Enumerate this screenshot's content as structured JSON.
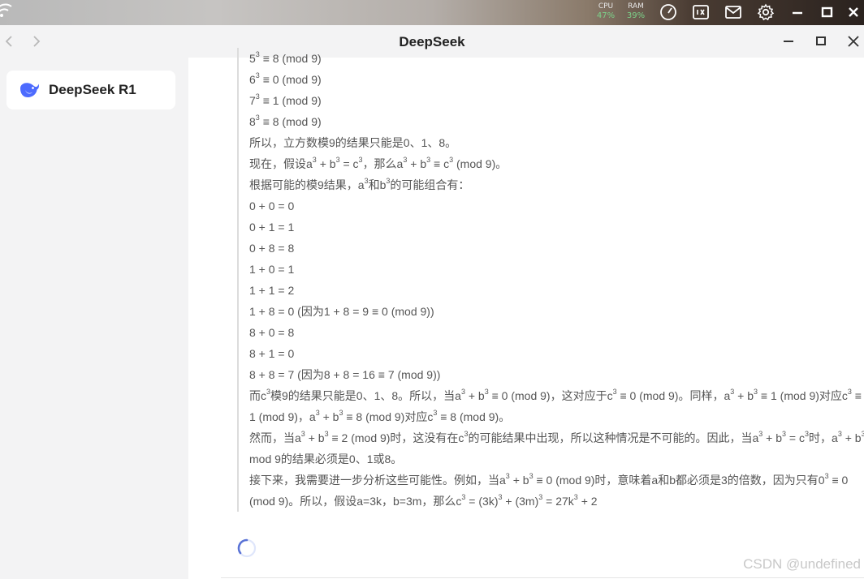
{
  "system_bar": {
    "cpu_label": "CPU",
    "cpu_value": "47%",
    "ram_label": "RAM",
    "ram_value": "39%",
    "icons": [
      "wifi-icon",
      "speedometer-icon",
      "monitor-icon",
      "mail-icon",
      "gear-icon",
      "minimize-icon",
      "maximize-icon",
      "close-icon"
    ]
  },
  "window": {
    "title": "DeepSeek",
    "nav_icons": [
      "back-arrow-icon",
      "forward-arrow-icon"
    ]
  },
  "sidebar": {
    "model_name": "DeepSeek R1",
    "model_icon": "deepseek-whale-icon",
    "accent": "#4d6bfe"
  },
  "thought_lines": [
    [
      [
        "t",
        "5"
      ],
      [
        "s",
        "3"
      ],
      [
        "t",
        " ≡ 8 (mod 9)"
      ]
    ],
    [
      [
        "t",
        "6"
      ],
      [
        "s",
        "3"
      ],
      [
        "t",
        " ≡ 0 (mod 9)"
      ]
    ],
    [
      [
        "t",
        "7"
      ],
      [
        "s",
        "3"
      ],
      [
        "t",
        " ≡ 1 (mod 9)"
      ]
    ],
    [
      [
        "t",
        "8"
      ],
      [
        "s",
        "3"
      ],
      [
        "t",
        " ≡ 8 (mod 9)"
      ]
    ],
    [
      [
        "t",
        "所以，立方数模9的结果只能是0、1、8。"
      ]
    ],
    [
      [
        "t",
        "现在，假设a"
      ],
      [
        "s",
        "3"
      ],
      [
        "t",
        " + b"
      ],
      [
        "s",
        "3"
      ],
      [
        "t",
        " = c"
      ],
      [
        "s",
        "3"
      ],
      [
        "t",
        "，那么a"
      ],
      [
        "s",
        "3"
      ],
      [
        "t",
        " + b"
      ],
      [
        "s",
        "3"
      ],
      [
        "t",
        " ≡ c"
      ],
      [
        "s",
        "3"
      ],
      [
        "t",
        " (mod 9)。"
      ]
    ],
    [
      [
        "t",
        "根据可能的模9结果，a"
      ],
      [
        "s",
        "3"
      ],
      [
        "t",
        "和b"
      ],
      [
        "s",
        "3"
      ],
      [
        "t",
        "的可能组合有："
      ]
    ],
    [
      [
        "t",
        "0 + 0 = 0"
      ]
    ],
    [
      [
        "t",
        "0 + 1 = 1"
      ]
    ],
    [
      [
        "t",
        "0 + 8 = 8"
      ]
    ],
    [
      [
        "t",
        "1 + 0 = 1"
      ]
    ],
    [
      [
        "t",
        "1 + 1 = 2"
      ]
    ],
    [
      [
        "t",
        "1 + 8 = 0 (因为1 + 8 = 9 ≡ 0 (mod 9))"
      ]
    ],
    [
      [
        "t",
        "8 + 0 = 8"
      ]
    ],
    [
      [
        "t",
        "8 + 1 = 0"
      ]
    ],
    [
      [
        "t",
        "8 + 8 = 7 (因为8 + 8 = 16 ≡ 7 (mod 9))"
      ]
    ],
    [
      [
        "t",
        "而c"
      ],
      [
        "s",
        "3"
      ],
      [
        "t",
        "模9的结果只能是0、1、8。所以，当a"
      ],
      [
        "s",
        "3"
      ],
      [
        "t",
        " + b"
      ],
      [
        "s",
        "3"
      ],
      [
        "t",
        " ≡ 0 (mod 9)，这对应于c"
      ],
      [
        "s",
        "3"
      ],
      [
        "t",
        " ≡ 0 (mod 9)。同样，a"
      ],
      [
        "s",
        "3"
      ],
      [
        "t",
        " + b"
      ],
      [
        "s",
        "3"
      ],
      [
        "t",
        " ≡ 1 (mod 9)对应c"
      ],
      [
        "s",
        "3"
      ],
      [
        "t",
        " ≡ 1 (mod 9)，a"
      ],
      [
        "s",
        "3"
      ],
      [
        "t",
        " + b"
      ],
      [
        "s",
        "3"
      ],
      [
        "t",
        " ≡ 8 (mod 9)对应c"
      ],
      [
        "s",
        "3"
      ],
      [
        "t",
        " ≡ 8 (mod 9)。"
      ]
    ],
    [
      [
        "t",
        "然而，当a"
      ],
      [
        "s",
        "3"
      ],
      [
        "t",
        " + b"
      ],
      [
        "s",
        "3"
      ],
      [
        "t",
        " ≡ 2 (mod 9)时，这没有在c"
      ],
      [
        "s",
        "3"
      ],
      [
        "t",
        "的可能结果中出现，所以这种情况是不可能的。因此，当a"
      ],
      [
        "s",
        "3"
      ],
      [
        "t",
        " + b"
      ],
      [
        "s",
        "3"
      ],
      [
        "t",
        " = c"
      ],
      [
        "s",
        "3"
      ],
      [
        "t",
        "时，a"
      ],
      [
        "s",
        "3"
      ],
      [
        "t",
        " + b"
      ],
      [
        "s",
        "3"
      ],
      [
        "t",
        " mod 9的结果必须是0、1或8。"
      ]
    ],
    [
      [
        "t",
        "接下来，我需要进一步分析这些可能性。例如，当a"
      ],
      [
        "s",
        "3"
      ],
      [
        "t",
        " + b"
      ],
      [
        "s",
        "3"
      ],
      [
        "t",
        " ≡ 0 (mod 9)时，意味着a和b都必须是3的倍数，因为只有0"
      ],
      [
        "s",
        "3"
      ],
      [
        "t",
        " ≡ 0 (mod 9)。所以，假设a=3k，b=3m，那么c"
      ],
      [
        "s",
        "3"
      ],
      [
        "t",
        " = (3k)"
      ],
      [
        "s",
        "3"
      ],
      [
        "t",
        " + (3m)"
      ],
      [
        "s",
        "3"
      ],
      [
        "t",
        " = 27k"
      ],
      [
        "s",
        "3"
      ],
      [
        "t",
        " + 2"
      ]
    ]
  ],
  "watermark": "CSDN @undefined"
}
